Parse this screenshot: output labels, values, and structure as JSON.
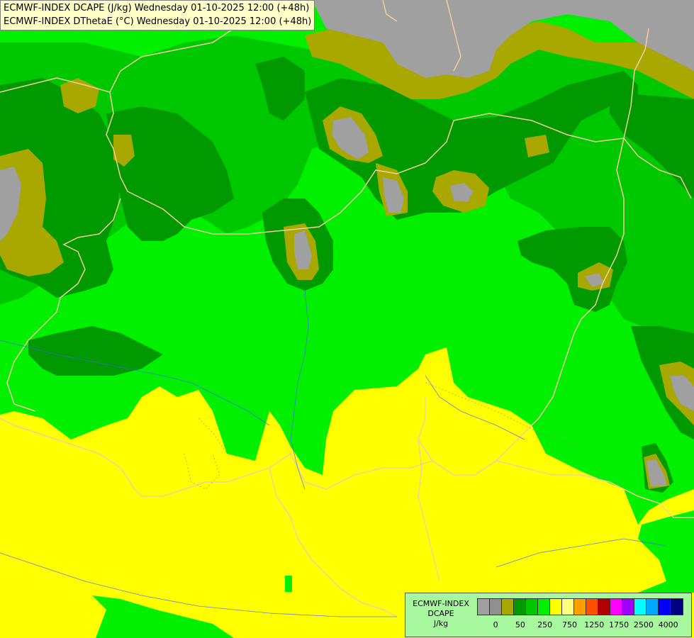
{
  "titles": {
    "line1": "ECMWF-INDEX DCAPE (J/kg) Wednesday 01-10-2025 12:00 (+48h)",
    "line2": "ECMWF-INDEX DThetaE (°C) Wednesday 01-10-2025 12:00 (+48h)"
  },
  "legend": {
    "name": "ECMWF-INDEX",
    "variable": "DCAPE",
    "unit": "J/kg",
    "colors": [
      "#a0a0a0",
      "#909090",
      "#a8a800",
      "#009a00",
      "#00c800",
      "#00f000",
      "#ffff00",
      "#ffff80",
      "#ffa000",
      "#ff5000",
      "#b00000",
      "#ff00ff",
      "#a000ff",
      "#00ffff",
      "#00a8ff",
      "#0000ff",
      "#000080"
    ],
    "tick_labels": [
      "0",
      "50",
      "250",
      "750",
      "1250",
      "1750",
      "2500",
      "4000"
    ]
  },
  "map_colors": {
    "yellow": "#ffff00",
    "light_green": "#00f000",
    "medium_green": "#00c800",
    "dark_green": "#009a00",
    "olive": "#a8a800",
    "gray": "#a0a0a0"
  }
}
